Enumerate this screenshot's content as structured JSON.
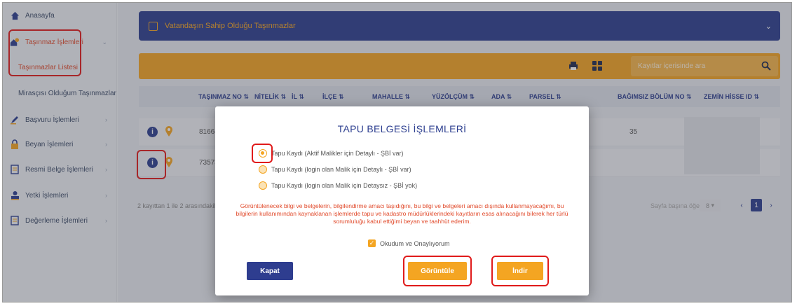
{
  "sidebar": {
    "items": [
      {
        "label": "Anasayfa",
        "icon": "home-icon"
      },
      {
        "label": "Taşınmaz İşlemleri",
        "icon": "house-pin-icon"
      },
      {
        "label": "Başvuru İşlemleri",
        "icon": "pen-icon"
      },
      {
        "label": "Beyan İşlemleri",
        "icon": "lock-icon"
      },
      {
        "label": "Resmi Belge İşlemleri",
        "icon": "document-icon"
      },
      {
        "label": "Yetki İşlemleri",
        "icon": "user-icon"
      },
      {
        "label": "Değerleme İşlemleri",
        "icon": "document-icon"
      }
    ],
    "sub_items": [
      {
        "label": "Taşınmazlar Listesi"
      },
      {
        "label": "Mirasçısı Olduğum Taşınmazlar"
      }
    ]
  },
  "header": {
    "title": "Vatandaşın Sahip Olduğu Taşınmazlar"
  },
  "toolbar": {
    "search_placeholder": "Kayıtlar içerisinde ara"
  },
  "table": {
    "columns": [
      "TAŞINMAZ NO",
      "NİTELİK",
      "İL",
      "İLÇE",
      "MAHALLE",
      "YÜZÖLÇÜM",
      "ADA",
      "PARSEL",
      "BAĞIMSIZ BÖLÜM NO",
      "ZEMİN HİSSE ID"
    ],
    "rows": [
      {
        "tasinmaz_no": "81665",
        "bagimsiz_bolum_no": "35"
      },
      {
        "tasinmaz_no": "73573",
        "bagimsiz_bolum_no": ""
      }
    ]
  },
  "pagination": {
    "summary": "2 kayıttan 1 ile 2 arasındakiler",
    "per_page_label": "Sayfa başına öğe:",
    "per_page_value": "8",
    "prev": "‹",
    "page": "1",
    "next": "›"
  },
  "modal": {
    "title": "TAPU BELGESİ İŞLEMLERİ",
    "options": [
      {
        "label": "Tapu Kaydı (Aktif Malikler için Detaylı - ŞBİ var)",
        "selected": true
      },
      {
        "label": "Tapu Kaydı (login olan Malik için Detaylı - ŞBİ var)",
        "selected": false
      },
      {
        "label": "Tapu Kaydı (login olan Malik için Detaysız - ŞBİ yok)",
        "selected": false
      }
    ],
    "disclaimer": "Görüntülenecek bilgi ve belgelerin, bilgilendirme amacı taşıdığını, bu bilgi ve belgeleri amacı dışında kullanmayacağımı, bu bilgilerin kullanımından kaynaklanan işlemlerde tapu ve kadastro müdürlüklerindeki kayıtların esas alınacağını bilerek her türlü sorumluluğu kabul ettiğimi beyan ve taahhüt ederim.",
    "consent_label": "Okudum ve Onaylıyorum",
    "close_label": "Kapat",
    "view_label": "Görüntüle",
    "download_label": "İndir"
  },
  "colors": {
    "primary": "#2c3e8f",
    "accent": "#f4a522",
    "annotation": "#e01b1b",
    "warning_text": "#e14a2b"
  }
}
